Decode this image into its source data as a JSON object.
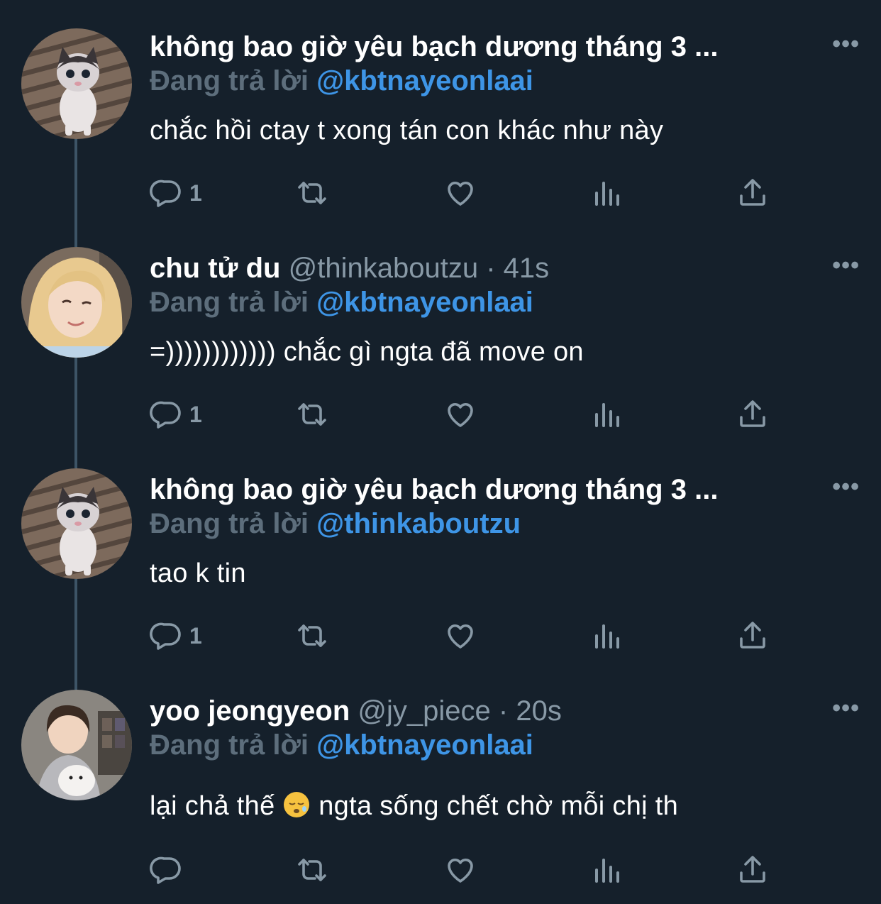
{
  "colors": {
    "background": "#15202b",
    "thread_line": "#3d5466",
    "secondary_text": "#8899a6",
    "mention": "#3e95e6"
  },
  "tweets": [
    {
      "display_name": "không bao giờ yêu bạch dương tháng 3 ...",
      "handle": "",
      "time": "",
      "reply_prefix": "Đang trả lời",
      "reply_to": "@kbtnayeonlaai",
      "text": "chắc hồi ctay t xong tán con khác như này",
      "reply_count": "1",
      "avatar": "kitten-avatar"
    },
    {
      "display_name": "chu tử du",
      "handle": "@thinkaboutzu",
      "time": "41s",
      "reply_prefix": "Đang trả lời",
      "reply_to": "@kbtnayeonlaai",
      "text": "=)))))))))))) chắc gì ngta đã move on",
      "reply_count": "1",
      "avatar": "blonde-girl-avatar"
    },
    {
      "display_name": "không bao giờ yêu bạch dương tháng 3 ...",
      "handle": "",
      "time": "",
      "reply_prefix": "Đang trả lời",
      "reply_to": "@thinkaboutzu",
      "text": "tao k tin",
      "reply_count": "1",
      "avatar": "kitten-avatar"
    },
    {
      "display_name": "yoo jeongyeon",
      "handle": "@jy_piece",
      "time": "20s",
      "reply_prefix": "Đang trả lời",
      "reply_to": "@kbtnayeonlaai",
      "text_before_emoji": "lại chả thế",
      "emoji": "sleeping-face-emoji",
      "text_after_emoji": "ngta sống chết chờ mỗi chị th",
      "reply_count": "",
      "avatar": "girl-with-dog-avatar"
    }
  ],
  "more_label": "•••"
}
